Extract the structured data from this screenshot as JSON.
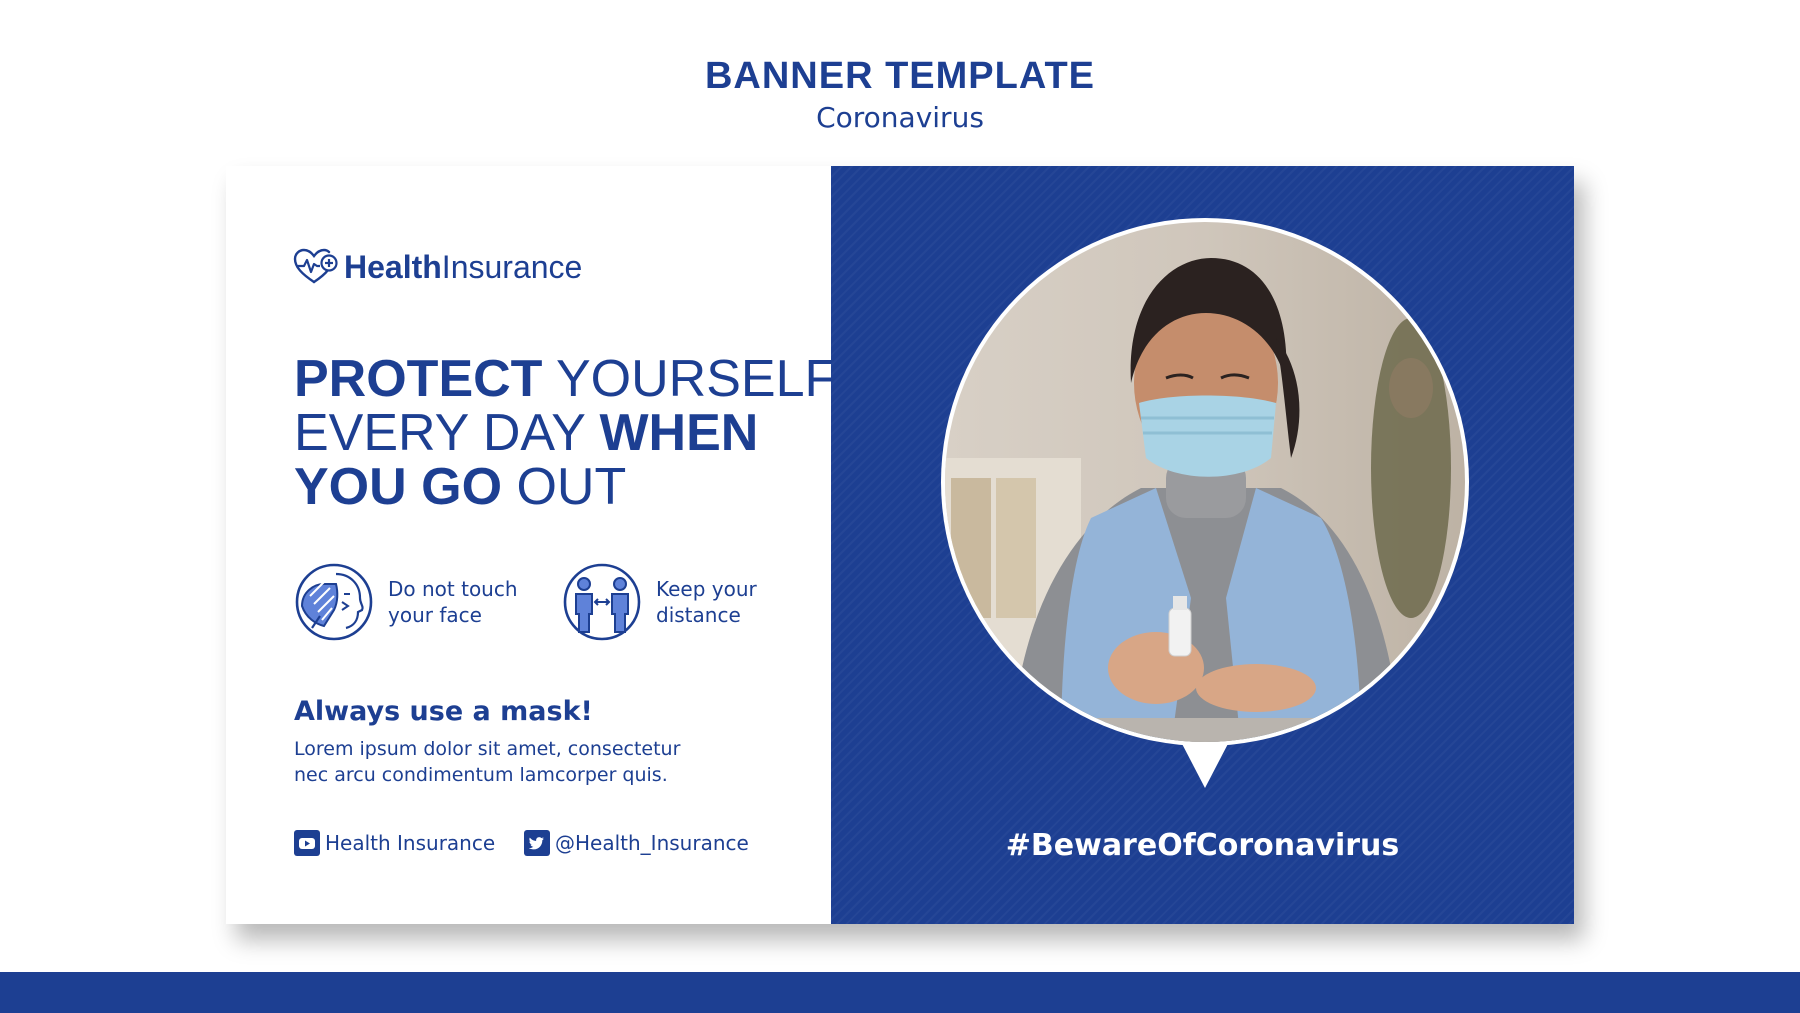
{
  "page": {
    "title": "BANNER TEMPLATE",
    "subtitle": "Coronavirus"
  },
  "logo": {
    "bold": "Health",
    "light": "Insurance",
    "icon": "heart-pulse-plus-icon"
  },
  "headline": {
    "line1_bold": "PROTECT",
    "line1_light": " YOURSELF",
    "line2_light": "EVERY DAY ",
    "line2_bold": "WHEN",
    "line3_bold": "YOU GO",
    "line3_light": " OUT"
  },
  "tips": [
    {
      "icon": "no-face-touch-icon",
      "line1": "Do not touch",
      "line2": "your face"
    },
    {
      "icon": "social-distance-icon",
      "line1": "Keep your",
      "line2": "distance"
    }
  ],
  "mask": {
    "title": "Always use a mask!",
    "body_line1": "Lorem ipsum dolor sit amet, consectetur",
    "body_line2": "nec arcu condimentum lamcorper quis."
  },
  "social": {
    "youtube": {
      "icon": "youtube-icon",
      "text": "Health Insurance"
    },
    "twitter": {
      "icon": "twitter-icon",
      "text": "@Health_Insurance"
    }
  },
  "photo": {
    "hashtag": "#BewareOfCoronavirus"
  },
  "colors": {
    "brand_blue": "#1d3f92",
    "white": "#ffffff"
  }
}
